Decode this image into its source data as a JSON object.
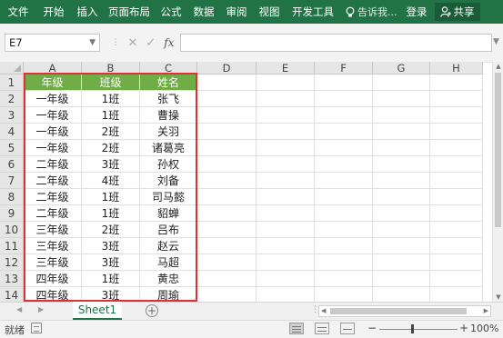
{
  "ribbon": {
    "tabs": [
      "文件",
      "开始",
      "插入",
      "页面布局",
      "公式",
      "数据",
      "审阅",
      "视图",
      "开发工具"
    ],
    "search_label": "告诉我...",
    "login_label": "登录",
    "share_label": "共享",
    "accent_color": "#217346"
  },
  "formula_bar": {
    "name_box": "E7",
    "formula_value": "",
    "fx_label": "fx"
  },
  "grid": {
    "columns": [
      "A",
      "B",
      "C",
      "D",
      "E",
      "F",
      "G",
      "H"
    ],
    "row_numbers": [
      "1",
      "2",
      "3",
      "4",
      "5",
      "6",
      "7",
      "8",
      "9",
      "10",
      "11",
      "12",
      "13",
      "14"
    ],
    "rows": [
      [
        "年级",
        "班级",
        "姓名"
      ],
      [
        "一年级",
        "1班",
        "张飞"
      ],
      [
        "一年级",
        "1班",
        "曹操"
      ],
      [
        "一年级",
        "2班",
        "关羽"
      ],
      [
        "一年级",
        "2班",
        "诸葛亮"
      ],
      [
        "二年级",
        "3班",
        "孙权"
      ],
      [
        "二年级",
        "4班",
        "刘备"
      ],
      [
        "二年级",
        "1班",
        "司马懿"
      ],
      [
        "二年级",
        "1班",
        "貂蝉"
      ],
      [
        "三年级",
        "2班",
        "吕布"
      ],
      [
        "三年级",
        "3班",
        "赵云"
      ],
      [
        "三年级",
        "3班",
        "马超"
      ],
      [
        "四年级",
        "1班",
        "黄忠"
      ],
      [
        "四年级",
        "3班",
        "周瑜"
      ]
    ],
    "header_fill_color": "#70ad47",
    "selection_border_color": "#e0303a"
  },
  "sheets": {
    "tabs": [
      "Sheet1"
    ],
    "active": "Sheet1"
  },
  "status": {
    "ready_label": "就绪",
    "zoom_label": "100%",
    "zoom_minus": "−",
    "zoom_plus": "+"
  }
}
